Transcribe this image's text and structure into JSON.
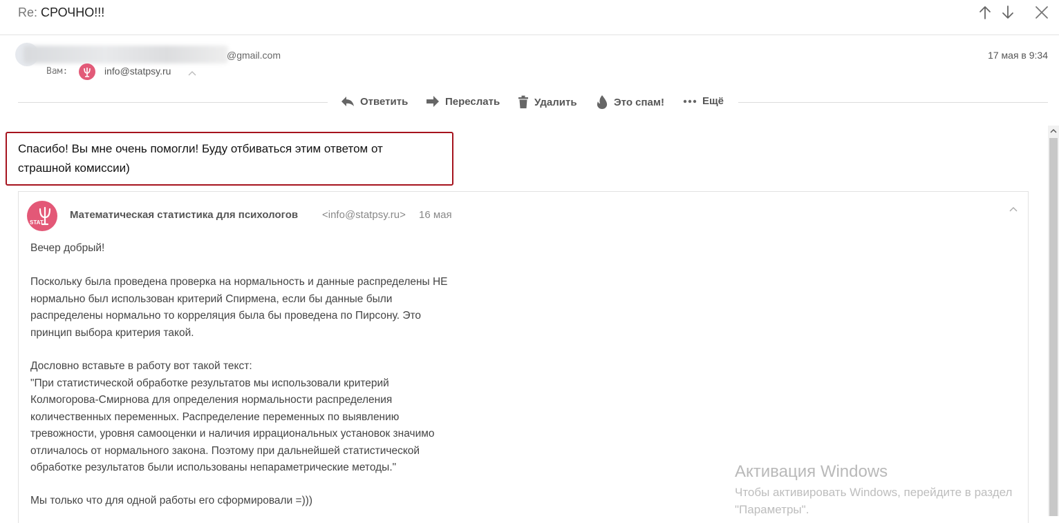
{
  "header": {
    "subject_prefix": "Re:",
    "subject": "СРОЧНО!!!",
    "prev_icon": "arrow-up-icon",
    "next_icon": "arrow-down-icon",
    "close_icon": "close-icon"
  },
  "sender": {
    "email_domain": "@gmail.com",
    "date": "17 мая в 9:34",
    "to_label": "Вам:",
    "to_email": "info@statpsy.ru"
  },
  "toolbar": {
    "reply": "Ответить",
    "forward": "Переслать",
    "delete": "Удалить",
    "spam": "Это спам!",
    "more": "Ещё"
  },
  "reply": {
    "line1": "Спасибо! Вы мне очень помогли! Буду отбиваться этим ответом от",
    "line2": "страшной комиссии)"
  },
  "quoted": {
    "sender_name": "Математическая статистика для психологов",
    "sender_email": "<info@statpsy.ru>",
    "date": "16 мая",
    "logo_text": "STAT",
    "body": [
      "Вечер добрый!",
      "Поскольку была проведена проверка на нормальность и данные распределены НЕ",
      "нормально был использован критерий Спирмена, если бы данные были",
      "распределены нормально то корреляция была бы проведена по Пирсону. Это",
      "принцип выбора критерия такой.",
      "Дословно вставьте в работу вот такой текст:",
      "\"При статистической обработке результатов мы использовали критерий",
      "Колмогорова-Смирнова для определения нормальности распределения",
      "количественных переменных. Распределение переменных по выявлению",
      "тревожности, уровня самооценки и наличия иррациональных установок значимо",
      "отличалось от нормального закона. Поэтому при дальнейшей статистической",
      "обработке результатов были использованы непараметрические методы.\"",
      "Мы только что для одной работы его сформировали =)))"
    ]
  },
  "watermark": {
    "title": "Активация Windows",
    "line1": "Чтобы активировать Windows, перейдите в раздел",
    "line2": "\"Параметры\"."
  },
  "colors": {
    "brand_pink": "#e35877",
    "highlight_border": "#a5121d"
  }
}
